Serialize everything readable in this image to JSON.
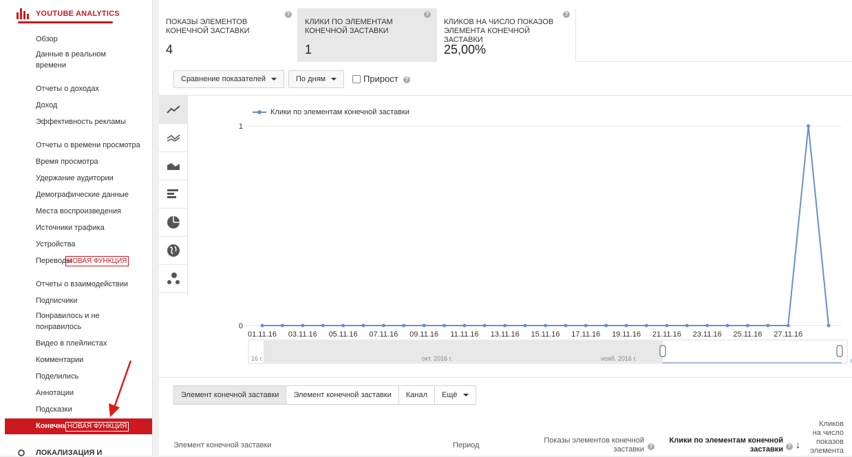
{
  "sidebar": {
    "title": "YOUTUBE ANALYTICS",
    "items": [
      {
        "label": "Обзор"
      },
      {
        "label": "Данные в реальном времени"
      },
      {
        "label": "Отчеты о доходах"
      },
      {
        "label": "Доход"
      },
      {
        "label": "Эффективность рекламы"
      },
      {
        "label": "Отчеты о времени просмотра"
      },
      {
        "label": "Время просмотра"
      },
      {
        "label": "Удержание аудитории"
      },
      {
        "label": "Демографические данные"
      },
      {
        "label": "Места воспроизведения"
      },
      {
        "label": "Источники трафика"
      },
      {
        "label": "Устройства"
      },
      {
        "label": "Переводы"
      },
      {
        "label": "Отчеты о взаимодействии"
      },
      {
        "label": "Подписчики"
      },
      {
        "label": "Понравилось и не понравилось"
      },
      {
        "label": "Видео в плейлистах"
      },
      {
        "label": "Комментарии"
      },
      {
        "label": "Поделились"
      },
      {
        "label": "Аннотации"
      },
      {
        "label": "Подсказки"
      }
    ],
    "new_badge": "НОВАЯ ФУНКЦИЯ",
    "active_item": "Конечные заставки",
    "active_badge": "НОВАЯ ФУНКЦИЯ",
    "localization": "ЛОКАЛИЗАЦИЯ И"
  },
  "metrics": [
    {
      "label": "ПОКАЗЫ ЭЛЕМЕНТОВ КОНЕЧНОЙ ЗАСТАВКИ",
      "value": "4"
    },
    {
      "label": "КЛИКИ ПО ЭЛЕМЕНТАМ КОНЕЧНОЙ ЗАСТАВКИ",
      "value": "1"
    },
    {
      "label": "КЛИКОВ НА ЧИСЛО ПОКАЗОВ ЭЛЕМЕНТА КОНЕЧНОЙ ЗАСТАВКИ",
      "value": "25,00%"
    }
  ],
  "toolbar": {
    "compare": "Сравнение показателей",
    "period": "По дням",
    "growth": "Прирост"
  },
  "chart_data": {
    "type": "line",
    "series": [
      {
        "name": "Клики по элементам конечной заставки",
        "values": [
          0,
          0,
          0,
          0,
          0,
          0,
          0,
          0,
          0,
          0,
          0,
          0,
          0,
          0,
          0,
          0,
          0,
          0,
          0,
          0,
          0,
          0,
          0,
          0,
          0,
          0,
          0,
          1,
          0
        ]
      }
    ],
    "x": [
      "01.11.16",
      "02.11.16",
      "03.11.16",
      "04.11.16",
      "05.11.16",
      "06.11.16",
      "07.11.16",
      "08.11.16",
      "09.11.16",
      "10.11.16",
      "11.11.16",
      "12.11.16",
      "13.11.16",
      "14.11.16",
      "15.11.16",
      "16.11.16",
      "17.11.16",
      "18.11.16",
      "19.11.16",
      "20.11.16",
      "21.11.16",
      "22.11.16",
      "23.11.16",
      "24.11.16",
      "25.11.16",
      "26.11.16",
      "27.11.16",
      "28.11.16",
      "29.11.16"
    ],
    "tick_labels": [
      "01.11.16",
      "03.11.16",
      "05.11.16",
      "07.11.16",
      "09.11.16",
      "11.11.16",
      "13.11.16",
      "15.11.16",
      "17.11.16",
      "19.11.16",
      "21.11.16",
      "23.11.16",
      "25.11.16",
      "27.11.16"
    ],
    "y_ticks": [
      "1",
      "0"
    ],
    "ylim": [
      0,
      1
    ],
    "color": "#6a8fc9",
    "legend": "top-left",
    "grid": true,
    "navigator_labels": [
      "16 г.",
      "окт. 2016 г.",
      "нояб. 2016 г."
    ]
  },
  "tabs": [
    "Элемент конечной заставки",
    "Элемент конечной заставки",
    "Канал",
    "Ещё"
  ],
  "table_headers": {
    "element": "Элемент конечной заставки",
    "period": "Период",
    "impressions": "Показы элементов конечной заставки",
    "clicks": "Клики по элементам конечной заставки",
    "ctr": "Кликов на число показов элемента"
  }
}
